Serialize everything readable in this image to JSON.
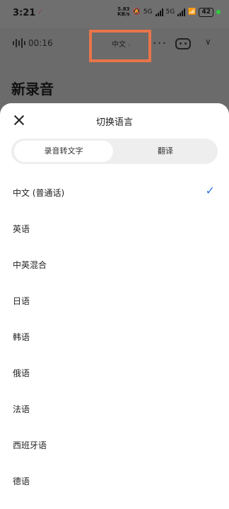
{
  "status_bar": {
    "time": "3:21",
    "net_speed_value": "5.83",
    "net_speed_unit": "KB/s",
    "sig1": "5G",
    "sig2": "5G",
    "battery": "42"
  },
  "toolbar": {
    "duration": "00:16",
    "language": "中文"
  },
  "page": {
    "title": "新录音"
  },
  "sheet": {
    "title": "切换语言",
    "tabs": [
      {
        "label": "录音转文字",
        "active": true
      },
      {
        "label": "翻译",
        "active": false
      }
    ],
    "languages": [
      {
        "label": "中文 (普通话)",
        "selected": true
      },
      {
        "label": "英语",
        "selected": false
      },
      {
        "label": "中英混合",
        "selected": false
      },
      {
        "label": "日语",
        "selected": false
      },
      {
        "label": "韩语",
        "selected": false
      },
      {
        "label": "俄语",
        "selected": false
      },
      {
        "label": "法语",
        "selected": false
      },
      {
        "label": "西班牙语",
        "selected": false
      },
      {
        "label": "德语",
        "selected": false
      }
    ]
  },
  "colors": {
    "highlight": "#e8754a",
    "check": "#3478d8"
  }
}
